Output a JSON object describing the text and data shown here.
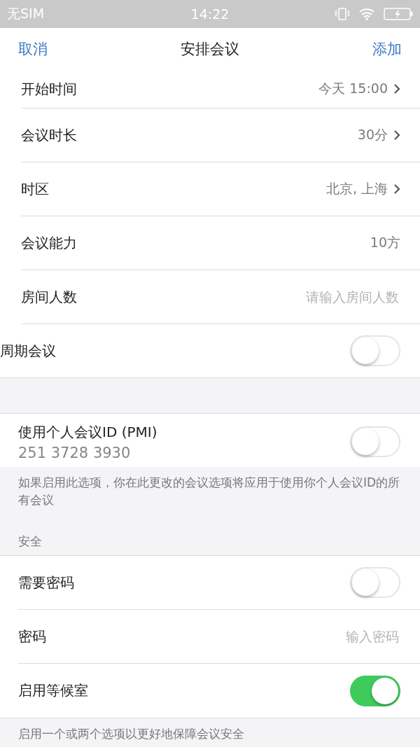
{
  "status_bar": {
    "carrier": "无SIM",
    "time": "14:22"
  },
  "nav": {
    "cancel": "取消",
    "title": "安排会议",
    "add": "添加"
  },
  "schedule_rows": [
    {
      "kind": "link",
      "label": "开始时间",
      "value": "今天 15:00"
    },
    {
      "kind": "link",
      "label": "会议时长",
      "value": "30分"
    },
    {
      "kind": "link",
      "label": "时区",
      "value": "北京, 上海"
    },
    {
      "kind": "value",
      "label": "会议能力",
      "value": "10方"
    },
    {
      "kind": "input",
      "label": "房间人数",
      "placeholder": "请输入房间人数"
    },
    {
      "kind": "toggle",
      "label": "周期会议",
      "on": false
    }
  ],
  "pmi": {
    "label": "使用个人会议ID (PMI)",
    "id": "251 3728 3930",
    "on": false,
    "note": "如果启用此选项，你在此更改的会议选项将应用于使用你个人会议ID的所有会议"
  },
  "security": {
    "header": "安全",
    "rows": [
      {
        "kind": "toggle",
        "label": "需要密码",
        "on": false
      },
      {
        "kind": "input",
        "label": "密码",
        "placeholder": "输入密码"
      },
      {
        "kind": "toggle",
        "label": "启用等候室",
        "on": true
      }
    ],
    "note": "启用一个或两个选项以更好地保障会议安全"
  }
}
